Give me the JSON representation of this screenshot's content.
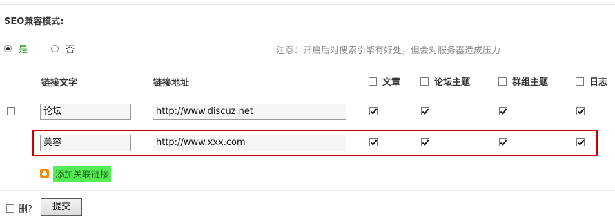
{
  "seo": {
    "title": "SEO兼容模式:",
    "options": [
      {
        "label": "是",
        "selected": true
      },
      {
        "label": "否",
        "selected": false
      }
    ],
    "notice": "注意：开启后对搜索引擎有好处，但会对服务器造成压力"
  },
  "table": {
    "headers": {
      "link_text": "链接文字",
      "link_url": "链接地址",
      "checks": [
        "文章",
        "论坛主题",
        "群组主题",
        "日志"
      ]
    },
    "rows": [
      {
        "text": "论坛",
        "url": "http://www.discuz.net",
        "checks": [
          true,
          true,
          true,
          true
        ],
        "delete_checkbox": true
      },
      {
        "text": "美容",
        "url": "http://www.xxx.com",
        "checks": [
          true,
          true,
          true,
          true
        ],
        "delete_checkbox": false
      }
    ]
  },
  "add_link_label": "添加关联链接",
  "delete_label": "删?",
  "submit_label": "提交",
  "colors": {
    "highlight_border": "#c80000",
    "add_label_bg": "#55ee55",
    "plus_icon": "#f08a00",
    "yes_label": "#1f9a1f"
  }
}
